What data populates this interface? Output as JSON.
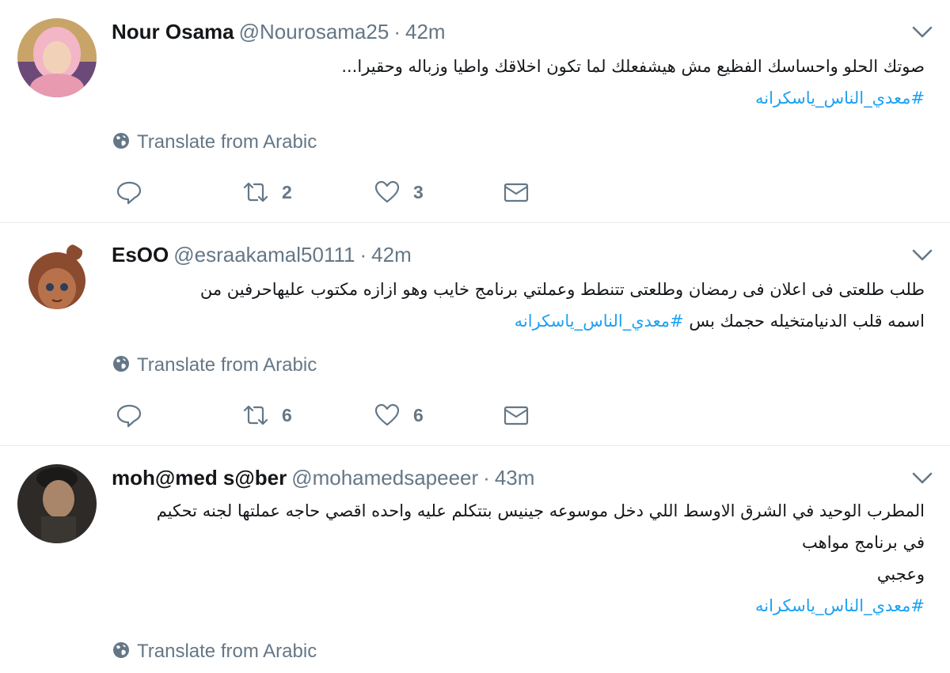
{
  "tweets": [
    {
      "name": "Nour Osama",
      "handle": "@Nourosama25",
      "separator": "·",
      "time": "42m",
      "lines": [
        "صوتك الحلو واحساسك الفظيع مش هيشفعلك لما تكون اخلاقك واطيا وزباله وحقيرا..."
      ],
      "last_line_prefix": "",
      "hashtag": "#معدي_الناس_ياسكرانه",
      "translate": "Translate from Arabic",
      "retweets": "2",
      "likes": "3"
    },
    {
      "name": "EsOO",
      "handle": "@esraakamal50111",
      "separator": "·",
      "time": "42m",
      "lines": [
        "طلب طلعتى فى اعلان فى رمضان وطلعتى تتنطط وعملتي برنامج خايب وهو ازازه مكتوب عليهاحرفين من"
      ],
      "last_line_prefix": "اسمه قلب الدنيامتخيله حجمك بس ",
      "hashtag": "#معدي_الناس_ياسكرانه",
      "translate": "Translate from Arabic",
      "retweets": "6",
      "likes": "6"
    },
    {
      "name": "moh@med s@ber",
      "handle": "@mohamedsapeeer",
      "separator": "·",
      "time": "43m",
      "lines": [
        "المطرب الوحيد في الشرق الاوسط اللي دخل موسوعه جينيس بتتكلم عليه واحده اقصي حاجه عملتها لجنه تحكيم",
        "في برنامج مواهب",
        "وعجبي"
      ],
      "last_line_prefix": "",
      "hashtag": "#معدي_الناس_ياسكرانه",
      "translate": "Translate from Arabic"
    }
  ],
  "icons": {
    "reply": "reply-icon",
    "retweet": "retweet-icon",
    "like": "heart-icon",
    "dm": "envelope-icon",
    "globe": "globe-icon",
    "caret": "chevron-down-icon"
  },
  "colors": {
    "text": "#14171a",
    "secondary": "#657786",
    "hashtag": "#1da1f2",
    "divider": "#e6ecf0"
  }
}
